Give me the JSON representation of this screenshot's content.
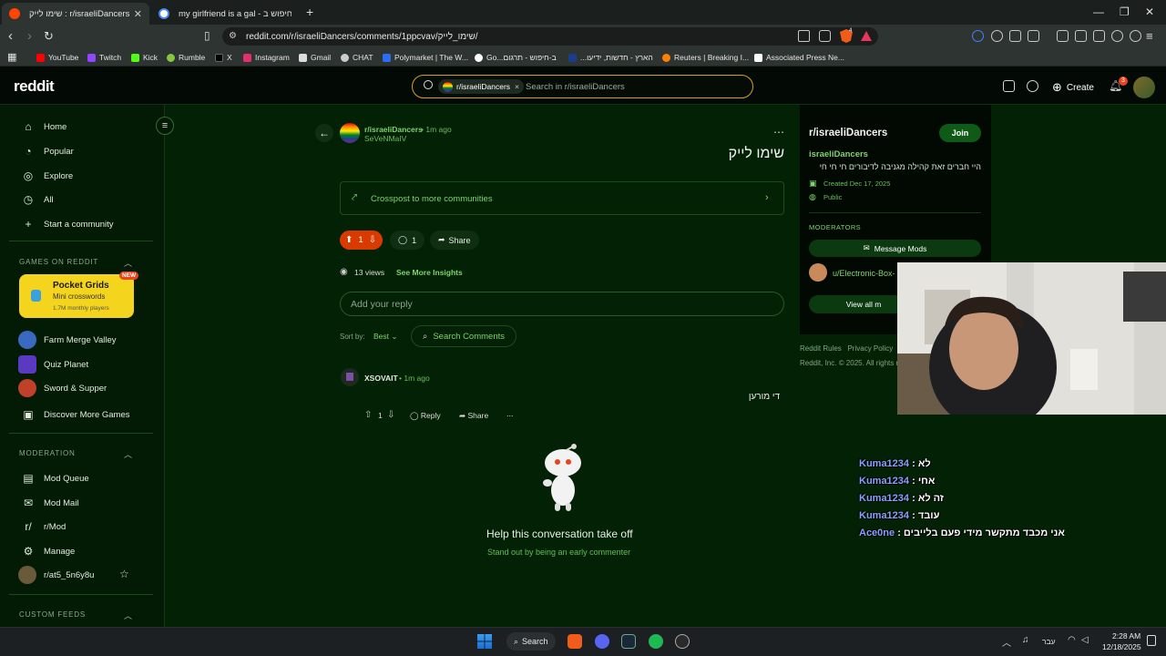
{
  "browser": {
    "tabs": [
      {
        "label": "r/israeliDancers : שימו לייק"
      },
      {
        "label": "my girlfriend is a gal - חיפוש ב-Goog"
      }
    ],
    "new_tab_glyph": "+",
    "url": "reddit.com/r/israeliDancers/comments/1ppcvav/שימו_לייק/",
    "window_controls": [
      "minimize-icon",
      "restore-icon",
      "close-icon"
    ],
    "shield_badge": "4"
  },
  "bookmarks": [
    {
      "label": "YouTube",
      "color": "#ff0000"
    },
    {
      "label": "Twitch",
      "color": "#9146ff"
    },
    {
      "label": "Kick",
      "color": "#53fc18"
    },
    {
      "label": "Rumble",
      "color": "#85c742"
    },
    {
      "label": "X",
      "color": "#000000"
    },
    {
      "label": "Instagram",
      "color": "#e1306c"
    },
    {
      "label": "Gmail",
      "color": "#dddddd"
    },
    {
      "label": "CHAT",
      "color": "#cccccc"
    },
    {
      "label": "Polymarket | The W...",
      "color": "#2d6cf6"
    },
    {
      "label": "Go...ב-חיפוש - תרגום",
      "color": "#4285f4"
    },
    {
      "label": "הארץ - חדשות, ידיעו...",
      "color": "#1a3e8c"
    },
    {
      "label": "Reuters | Breaking I...",
      "color": "#ff8000"
    },
    {
      "label": "Associated Press Ne...",
      "color": "#ffffff"
    }
  ],
  "reddit_header": {
    "logo": "reddit",
    "search_chip": "r/israeliDancers",
    "search_chip_close": "×",
    "search_placeholder": "Search in r/israeliDancers",
    "create_label": "Create",
    "notification_count": "3"
  },
  "sidebar": {
    "nav": [
      {
        "label": "Home",
        "icon": "home-icon"
      },
      {
        "label": "Popular",
        "icon": "popular-icon"
      },
      {
        "label": "Explore",
        "icon": "explore-icon"
      },
      {
        "label": "All",
        "icon": "all-icon"
      },
      {
        "label": "Start a community",
        "icon": "plus-icon"
      }
    ],
    "games_heading": "GAMES ON REDDIT",
    "pocket_grids": {
      "title": "Pocket Grids",
      "subtitle": "Mini crosswords",
      "players": "1.7M monthly players",
      "badge": "NEW"
    },
    "games": [
      {
        "label": "Farm Merge Valley"
      },
      {
        "label": "Quiz Planet"
      },
      {
        "label": "Sword & Supper"
      },
      {
        "label": "Discover More Games"
      }
    ],
    "moderation_heading": "MODERATION",
    "moderation": [
      {
        "label": "Mod Queue"
      },
      {
        "label": "Mod Mail"
      },
      {
        "label": "r/Mod"
      },
      {
        "label": "Manage"
      },
      {
        "label": "r/at5_5n6y8u"
      }
    ],
    "custom_feeds_heading": "CUSTOM FEEDS"
  },
  "post": {
    "subreddit": "r/israeliDancers",
    "time": "• 1m ago",
    "author": "SeVeNMaIV",
    "title": "שימו לייק",
    "crosspost": "Crosspost to more communities",
    "votes": "1",
    "comments": "1",
    "share": "Share",
    "views": "13 views",
    "insights": "See More Insights",
    "reply_placeholder": "Add your reply",
    "sort_label": "Sort by:",
    "sort_value": "Best",
    "search_comments": "Search Comments",
    "comment": {
      "author": "XSOVAIT",
      "time": "• 1m ago",
      "text": "די מורען",
      "votes": "1",
      "reply": "Reply",
      "share": "Share",
      "more": "..."
    },
    "empty_title": "Help this conversation take off",
    "empty_subtitle": "Stand out by being an early commenter"
  },
  "right_panel": {
    "name": "r/israeliDancers",
    "join": "Join",
    "display_name": "israeliDancers",
    "description": "היי חברים זאת קהילה מגניבה לדיבורים חי חי חי",
    "created": "Created Dec 17, 2025",
    "visibility": "Public",
    "moderators_heading": "MODERATORS",
    "message_mods": "Message Mods",
    "moderator": "u/Electronic-Box-",
    "view_all": "View all m",
    "footer_links": "Reddit Rules   Privacy Policy   U",
    "footer_copy": "Reddit, Inc. © 2025. All rights r"
  },
  "chat": [
    {
      "user": "Kuma1234",
      "text": "לא"
    },
    {
      "user": "Kuma1234",
      "text": "אחי"
    },
    {
      "user": "Kuma1234",
      "text": "זה לא"
    },
    {
      "user": "Kuma1234",
      "text": "עובד"
    },
    {
      "user": "Ace0ne",
      "text": "אני מכבד מתקשר מידי פעם בלייבים"
    }
  ],
  "taskbar": {
    "search": "Search",
    "language": "עבר",
    "time": "2:28 AM",
    "date": "12/18/2025"
  },
  "colors": {
    "accent_green": "#7fd46f",
    "upvote": "#d93a00",
    "background": "#032104"
  }
}
